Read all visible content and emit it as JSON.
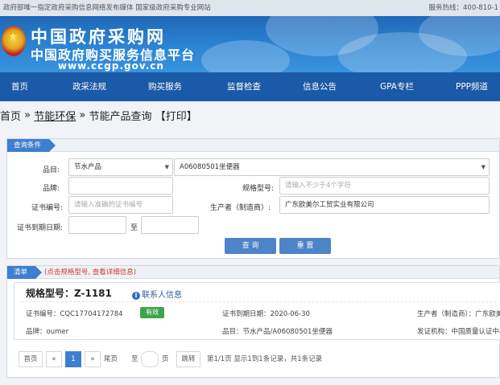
{
  "topbar": {
    "left_text": "政府部唯一指定政府采购信息网络发布媒体 国家级政府采购专业网站",
    "right_text": "服务热线：400-810-1"
  },
  "banner": {
    "title": "中国政府采购网",
    "subtitle": "中国政府购买服务信息平台",
    "url": "www.ccgp.gov.cn"
  },
  "nav": {
    "items": [
      "首页",
      "政采法规",
      "购买服务",
      "监督检查",
      "信息公告",
      "GPA专栏",
      "PPP频道"
    ]
  },
  "breadcrumb": {
    "home": "首页",
    "sep1": "»",
    "section": "节能环保",
    "sep2": "»",
    "current": "节能产品查询",
    "print": "【打印】"
  },
  "query": {
    "header": "查询条件",
    "item_label": "品目:",
    "item_select_1": "节水产品",
    "item_select_2": "A06080501坐便器",
    "brand_label": "品牌:",
    "brand_value": "",
    "model_label": "规格型号:",
    "model_placeholder": "请输入不少于4个字符",
    "cert_label": "证书编号:",
    "cert_placeholder": "请输入准确的证书编号",
    "maker_label": "生产者（制造商）:",
    "maker_value": "广东欧美尔工贸实业有限公司",
    "expiry_label": "证书到期日期:",
    "expiry_to": "至",
    "search_button": "查 询",
    "reset_button": "重 置"
  },
  "results": {
    "header": "清单",
    "hint": "(点击规格型号, 查看详细信息)",
    "model": "规格型号：Z-1181",
    "contact": "联系人信息",
    "cert_no": "证书编号：CQC17704172784",
    "status": "有效",
    "expiry": "证书到期日期：2020-06-30",
    "maker": "生产者（制造商）：广东欧美",
    "brand": "品牌：oumer",
    "category": "品目：节水产品/A06080501坐便器",
    "issuer": "发证机构：中国质量认证中心"
  },
  "pager": {
    "first": "首页",
    "prev": "«",
    "current": "1",
    "next": "»",
    "last": "尾页",
    "goto_pre": "至",
    "goto_post": "页",
    "jump": "跳转",
    "summary": "第1/1页  显示1到1条记录，共1条记录"
  },
  "colors": {
    "nav": "#1b5aa6",
    "banner": "#2c84d4",
    "accent": "#3c7fcf",
    "status_valid": "#3da64a",
    "hint_red": "#d23b2a"
  }
}
